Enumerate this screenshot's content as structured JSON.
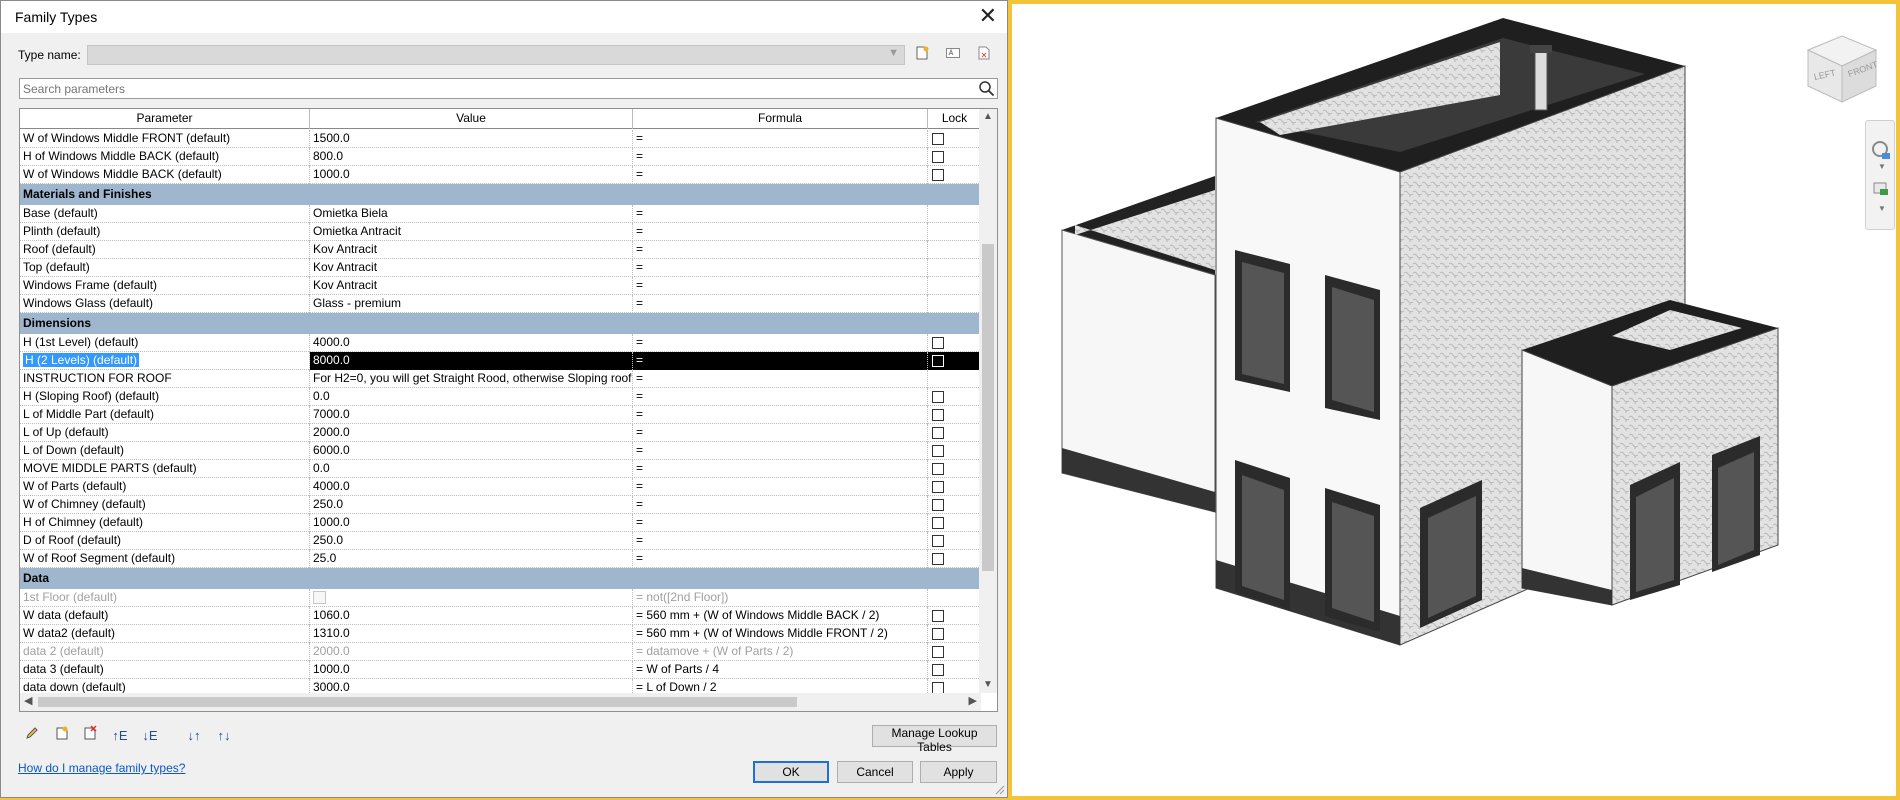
{
  "dialog": {
    "title": "Family Types",
    "type_name_label": "Type name:",
    "search_placeholder": "Search parameters",
    "help_link": "How do I manage family types?",
    "buttons": {
      "lookup": "Manage Lookup Tables",
      "ok": "OK",
      "cancel": "Cancel",
      "apply": "Apply"
    }
  },
  "icons": {
    "type_toolbar": [
      "new-type-icon",
      "rename-type-icon",
      "delete-type-icon"
    ],
    "bottom_toolbar": [
      "edit-parameter-icon",
      "new-parameter-icon",
      "delete-parameter-icon",
      "move-up-icon",
      "move-down-icon",
      "sort-ascending-icon",
      "sort-descending-icon"
    ]
  },
  "grid": {
    "columns": {
      "parameter": "Parameter",
      "value": "Value",
      "formula": "Formula",
      "lock": "Lock"
    },
    "rows": [
      {
        "kind": "row",
        "param": "W of Windows Middle FRONT (default)",
        "value": "1500.0",
        "formula": "=",
        "lock": true
      },
      {
        "kind": "row",
        "param": "H of Windows Middle BACK (default)",
        "value": "800.0",
        "formula": "=",
        "lock": true
      },
      {
        "kind": "row",
        "param": "W of Windows Middle BACK (default)",
        "value": "1000.0",
        "formula": "=",
        "lock": true
      },
      {
        "kind": "group",
        "label": "Materials and Finishes"
      },
      {
        "kind": "row",
        "param": "Base (default)",
        "value": "Omietka Biela",
        "formula": "=",
        "lock": false
      },
      {
        "kind": "row",
        "param": "Plinth (default)",
        "value": "Omietka Antracit",
        "formula": "=",
        "lock": false
      },
      {
        "kind": "row",
        "param": "Roof (default)",
        "value": "Kov Antracit",
        "formula": "=",
        "lock": false
      },
      {
        "kind": "row",
        "param": "Top (default)",
        "value": "Kov Antracit",
        "formula": "=",
        "lock": false
      },
      {
        "kind": "row",
        "param": "Windows Frame (default)",
        "value": "Kov Antracit",
        "formula": "=",
        "lock": false
      },
      {
        "kind": "row",
        "param": "Windows Glass (default)",
        "value": "Glass - premium",
        "formula": "=",
        "lock": false
      },
      {
        "kind": "group",
        "label": "Dimensions"
      },
      {
        "kind": "row",
        "param": "H (1st Level) (default)",
        "value": "4000.0",
        "formula": "=",
        "lock": true
      },
      {
        "kind": "row",
        "param": "H (2 Levels) (default)",
        "value": "8000.0",
        "formula": "=",
        "lock": true,
        "selected": true
      },
      {
        "kind": "row",
        "param": "INSTRUCTION FOR ROOF",
        "value": "For H2=0, you will get Straight Rood, otherwise Sloping roof",
        "formula": "=",
        "lock": false
      },
      {
        "kind": "row",
        "param": "H (Sloping Roof) (default)",
        "value": "0.0",
        "formula": "=",
        "lock": true
      },
      {
        "kind": "row",
        "param": "L of Middle Part (default)",
        "value": "7000.0",
        "formula": "=",
        "lock": true
      },
      {
        "kind": "row",
        "param": "L of Up (default)",
        "value": "2000.0",
        "formula": "=",
        "lock": true
      },
      {
        "kind": "row",
        "param": "L of Down (default)",
        "value": "6000.0",
        "formula": "=",
        "lock": true
      },
      {
        "kind": "row",
        "param": "MOVE MIDDLE PARTS (default)",
        "value": "0.0",
        "formula": "=",
        "lock": true
      },
      {
        "kind": "row",
        "param": "W of Parts (default)",
        "value": "4000.0",
        "formula": "=",
        "lock": true
      },
      {
        "kind": "row",
        "param": "W of Chimney (default)",
        "value": "250.0",
        "formula": "=",
        "lock": true
      },
      {
        "kind": "row",
        "param": "H of Chimney (default)",
        "value": "1000.0",
        "formula": "=",
        "lock": true
      },
      {
        "kind": "row",
        "param": "D of Roof (default)",
        "value": "250.0",
        "formula": "=",
        "lock": true
      },
      {
        "kind": "row",
        "param": "W of Roof Segment (default)",
        "value": "25.0",
        "formula": "=",
        "lock": true
      },
      {
        "kind": "group",
        "label": "Data"
      },
      {
        "kind": "row",
        "param": "1st Floor (default)",
        "value": "",
        "valueCheckbox": true,
        "formula": "= not([2nd Floor])",
        "lock": false,
        "disabled": true
      },
      {
        "kind": "row",
        "param": "W data (default)",
        "value": "1060.0",
        "formula": "= 560 mm + (W of Windows Middle BACK / 2)",
        "lock": true
      },
      {
        "kind": "row",
        "param": "W data2 (default)",
        "value": "1310.0",
        "formula": "= 560 mm + (W of Windows Middle FRONT / 2)",
        "lock": true
      },
      {
        "kind": "row",
        "param": "data 2 (default)",
        "value": "2000.0",
        "formula": "= datamove + (W of Parts / 2)",
        "lock": true,
        "disabled": true
      },
      {
        "kind": "row",
        "param": "data 3 (default)",
        "value": "1000.0",
        "formula": "= W of Parts / 4",
        "lock": true
      },
      {
        "kind": "row",
        "param": "data down (default)",
        "value": "3000.0",
        "formula": "= L of Down / 2",
        "lock": true
      }
    ]
  },
  "viewcube": {
    "left": "LEFT",
    "front": "FRONT"
  },
  "colors": {
    "group_header": "#9fb6cf",
    "selection": "#000000",
    "link": "#0b57c5",
    "accent_frame": "#f3c43a"
  }
}
